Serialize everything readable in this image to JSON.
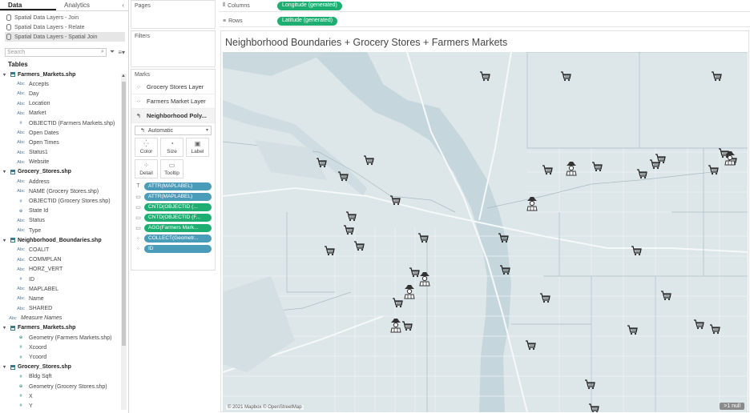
{
  "tabs": {
    "data": "Data",
    "analytics": "Analytics"
  },
  "sources": [
    "Spatial Data Layers - Join",
    "Spatial Data Layers - Relate",
    "Spatial Data Layers - Spatial Join"
  ],
  "search": {
    "placeholder": "Search"
  },
  "tables_header": "Tables",
  "fields": [
    {
      "kind": "table",
      "label": "Farmers_Markets.shp"
    },
    {
      "kind": "dim",
      "type": "Abc",
      "label": "Accepts"
    },
    {
      "kind": "dim",
      "type": "Abc",
      "label": "Day"
    },
    {
      "kind": "dim",
      "type": "Abc",
      "label": "Location"
    },
    {
      "kind": "dim",
      "type": "Abc",
      "label": "Market"
    },
    {
      "kind": "dim",
      "type": "#",
      "label": "OBJECTID (Farmers Markets.shp)"
    },
    {
      "kind": "dim",
      "type": "Abc",
      "label": "Open Dates"
    },
    {
      "kind": "dim",
      "type": "Abc",
      "label": "Open Times"
    },
    {
      "kind": "dim",
      "type": "Abc",
      "label": "Status1"
    },
    {
      "kind": "dim",
      "type": "Abc",
      "label": "Website"
    },
    {
      "kind": "table",
      "label": "Grocery_Stores.shp"
    },
    {
      "kind": "dim",
      "type": "Abc",
      "label": "Address"
    },
    {
      "kind": "dim",
      "type": "Abc",
      "label": "NAME (Grocery Stores.shp)"
    },
    {
      "kind": "dim",
      "type": "#",
      "label": "OBJECTID (Grocery Stores.shp)"
    },
    {
      "kind": "dim",
      "type": "⊕",
      "label": "State Id"
    },
    {
      "kind": "dim",
      "type": "Abc",
      "label": "Status"
    },
    {
      "kind": "dim",
      "type": "Abc",
      "label": "Type"
    },
    {
      "kind": "table",
      "label": "Neighborhood_Boundaries.shp"
    },
    {
      "kind": "dim",
      "type": "Abc",
      "label": "COALIT"
    },
    {
      "kind": "dim",
      "type": "Abc",
      "label": "COMMPLAN"
    },
    {
      "kind": "dim",
      "type": "Abc",
      "label": "HORZ_VERT"
    },
    {
      "kind": "dim",
      "type": "#",
      "label": "ID"
    },
    {
      "kind": "dim",
      "type": "Abc",
      "label": "MAPLABEL"
    },
    {
      "kind": "dim",
      "type": "Abc",
      "label": "Name"
    },
    {
      "kind": "dim",
      "type": "Abc",
      "label": "SHARED"
    },
    {
      "kind": "italic",
      "type": "Abc",
      "label": "Measure Names"
    },
    {
      "kind": "table",
      "label": "Farmers_Markets.shp"
    },
    {
      "kind": "mes",
      "type": "⊕",
      "label": "Geometry (Farmers Markets.shp)"
    },
    {
      "kind": "mes",
      "type": "#",
      "label": "Xcoord"
    },
    {
      "kind": "mes",
      "type": "#",
      "label": "Ycoord"
    },
    {
      "kind": "table",
      "label": "Grocery_Stores.shp"
    },
    {
      "kind": "mes",
      "type": "#",
      "label": "Bldg Sqft"
    },
    {
      "kind": "mes",
      "type": "⊕",
      "label": "Geometry (Grocery Stores.shp)"
    },
    {
      "kind": "mes",
      "type": "#",
      "label": "X"
    },
    {
      "kind": "mes",
      "type": "#",
      "label": "Y"
    }
  ],
  "pages_label": "Pages",
  "filters_label": "Filters",
  "marks": {
    "label": "Marks",
    "layers": [
      "Grocery Stores Layer",
      "Farmers Market Layer",
      "Neighborhood Poly..."
    ],
    "mark_type": "Automatic",
    "buttons": [
      "Color",
      "Size",
      "Label",
      "Detail",
      "Tooltip"
    ],
    "pills": [
      {
        "icon": "T",
        "label": "ATTR(MAPLABEL)",
        "color": "blue"
      },
      {
        "icon": "▭",
        "label": "ATTR(MAPLABEL)",
        "color": "blue"
      },
      {
        "icon": "▭",
        "label": "CNTD(OBJECTID (...",
        "color": "green"
      },
      {
        "icon": "▭",
        "label": "CNTD(OBJECTID (F...",
        "color": "green"
      },
      {
        "icon": "▭",
        "label": "AGG(Farmers Mark...",
        "color": "green"
      },
      {
        "icon": "⁘",
        "label": "COLLECT(Geometr...",
        "color": "blue"
      },
      {
        "icon": "⁘",
        "label": "ID",
        "color": "blue"
      }
    ]
  },
  "shelves": {
    "columns_label": "Columns",
    "columns_pill": "Longitude (generated)",
    "rows_label": "Rows",
    "rows_pill": "Latitude (generated)"
  },
  "viz": {
    "title": "Neighborhood Boundaries + Grocery Stores + Farmers Markets",
    "attribution": "© 2021 Mapbox © OpenStreetMap",
    "null_badge": ">1 null"
  },
  "colors": {
    "map_bg": "#dde6e9",
    "water": "#c5d6dc",
    "river": "#eef3f5",
    "pill_green": "#1fae72",
    "pill_blue": "#4a9cb8"
  }
}
